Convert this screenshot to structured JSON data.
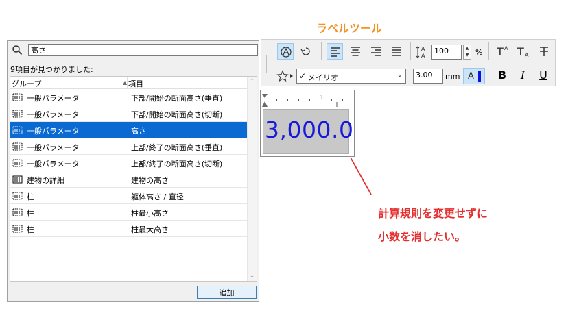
{
  "annotation_title": "ラベルツール",
  "search": {
    "value": "高さ"
  },
  "results_count": "9項目が見つかりました:",
  "columns": {
    "group": "グループ",
    "item": "項目"
  },
  "rows": [
    {
      "group": "一般パラメータ",
      "item": "下部/開始の断面高さ(垂直)",
      "icon": "general-param-icon"
    },
    {
      "group": "一般パラメータ",
      "item": "下部/開始の断面高さ(切断)",
      "icon": "general-param-icon"
    },
    {
      "group": "一般パラメータ",
      "item": "高さ",
      "icon": "general-param-icon",
      "selected": true
    },
    {
      "group": "一般パラメータ",
      "item": "上部/終了の断面高さ(垂直)",
      "icon": "general-param-icon"
    },
    {
      "group": "一般パラメータ",
      "item": "上部/終了の断面高さ(切断)",
      "icon": "general-param-icon"
    },
    {
      "group": "建物の詳細",
      "item": "建物の高さ",
      "icon": "building-icon"
    },
    {
      "group": "柱",
      "item": "躯体高さ / 直径",
      "icon": "general-param-icon"
    },
    {
      "group": "柱",
      "item": "柱最小高さ",
      "icon": "general-param-icon"
    },
    {
      "group": "柱",
      "item": "柱最大高さ",
      "icon": "general-param-icon"
    }
  ],
  "add_button": "追加",
  "toolbar": {
    "line_spacing": "100",
    "line_spacing_unit": "%",
    "font_name": "メイリオ",
    "font_size": "3.00",
    "font_size_unit": "mm",
    "text_color": "#1010e0",
    "bold": "B",
    "italic": "I",
    "underline": "U",
    "color_label": "A"
  },
  "preview": {
    "ruler_mark": "1",
    "value": "3,000.0",
    "value_color": "#1818d8"
  },
  "annotation": {
    "line1": "計算規則を変更せずに",
    "line2": "小数を消したい。",
    "color": "#e52e2e"
  }
}
